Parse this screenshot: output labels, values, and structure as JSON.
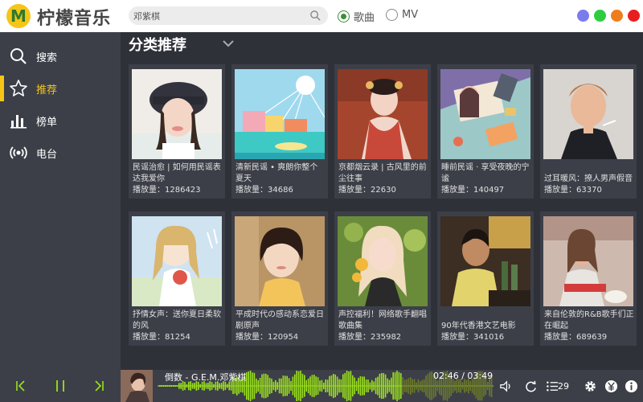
{
  "app": {
    "logo_letter": "M",
    "name": "柠檬音乐"
  },
  "search": {
    "value": "邓紫棋"
  },
  "search_type": {
    "options": [
      "歌曲",
      "MV"
    ],
    "selected": "歌曲"
  },
  "window_circles": [
    "#7b7bf0",
    "#2ecc40",
    "#f07d1a",
    "#e81f1f"
  ],
  "sidebar": {
    "items": [
      {
        "label": "搜索",
        "icon": "search-icon"
      },
      {
        "label": "推荐",
        "icon": "star-icon",
        "active": true
      },
      {
        "label": "榜单",
        "icon": "chart-bars-icon"
      },
      {
        "label": "电台",
        "icon": "broadcast-icon"
      }
    ]
  },
  "main": {
    "section_title": "分类推荐",
    "playlists": [
      {
        "title": "民谣治愈 | 如何用民谣表达我爱你",
        "plays": "播放量：1286423"
      },
      {
        "title": "清新民谣 • 爽朗你整个夏天",
        "plays": "播放量：34686"
      },
      {
        "title": "京都烟云录 | 古风里的前尘往事",
        "plays": "播放量：22630"
      },
      {
        "title": "睡前民谣 · 享受夜晚的宁谧",
        "plays": "播放量：140497"
      },
      {
        "title": "过耳暖风：撩人男声假音",
        "plays": "播放量：63370"
      },
      {
        "title": "抒情女声：送你夏日柔软的风",
        "plays": "播放量：81254"
      },
      {
        "title": "平成时代の感动系恋爱日剧原声",
        "plays": "播放量：120954"
      },
      {
        "title": "声控福利！网络歌手翻唱歌曲集",
        "plays": "播放量：235982"
      },
      {
        "title": "90年代香港文艺电影",
        "plays": "播放量：341016"
      },
      {
        "title": "来自伦敦的R&B歌手们正在崛起",
        "plays": "播放量：689639"
      }
    ]
  },
  "player": {
    "song": "倒数 - G.E.M.邓紫棋",
    "time": "02:46 / 03:49",
    "progress": 0.725,
    "queue_count": "29",
    "accent": "#9be31b"
  }
}
